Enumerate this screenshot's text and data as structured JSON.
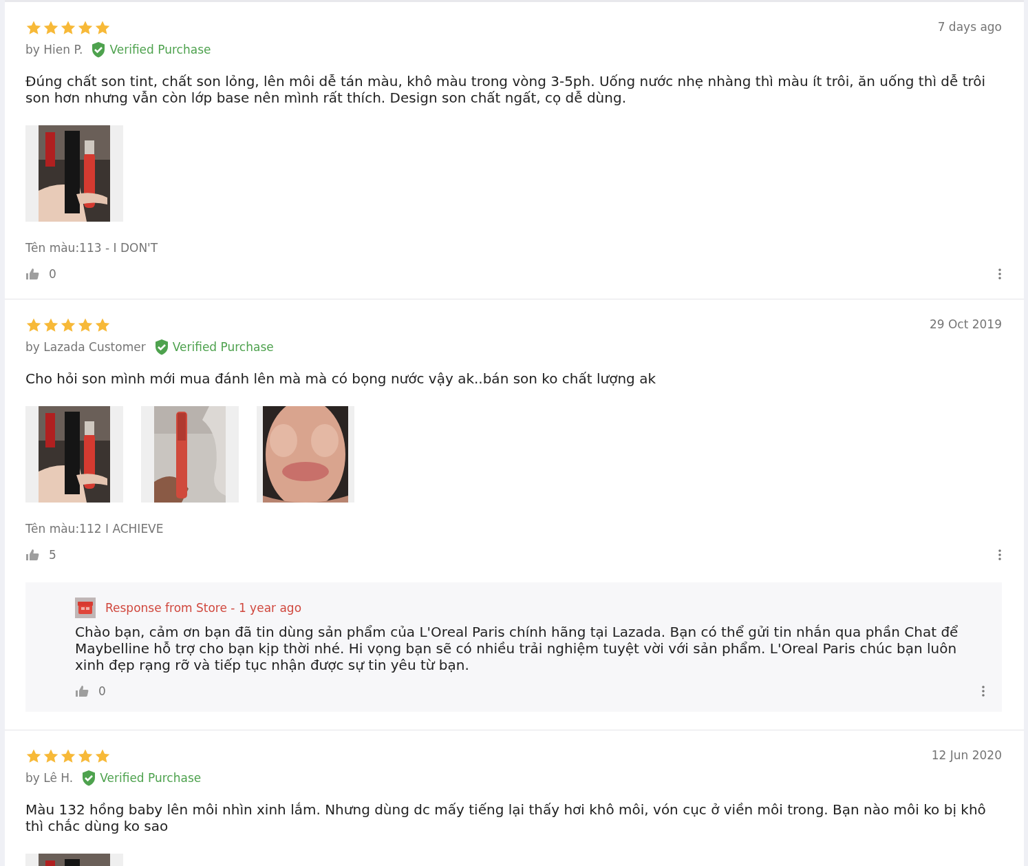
{
  "reviews": [
    {
      "stars": 5,
      "date": "7 days ago",
      "author": "by Hien P.",
      "verified": "Verified Purchase",
      "text": "Đúng chất son tint, chất son lỏng, lên môi dễ tán màu, khô màu trong vòng 3-5ph. Uống nước nhẹ nhàng thì màu ít trôi, ăn uống thì dễ trôi son hơn nhưng vẫn còn lớp base nên mình rất thích. Design son chất ngất, cọ dễ dùng.",
      "photos": [
        {
          "kind": "picture"
        }
      ],
      "variant": "Tên màu:113 - I DON'T",
      "likes": "0"
    },
    {
      "stars": 5,
      "date": "29 Oct 2019",
      "author": "by Lazada Customer",
      "verified": "Verified Purchase",
      "text": "Cho hỏi son mình mới mua đánh lên mà mà có bọng nước vậy ak..bán son ko chất lượng ak",
      "photos": [
        {
          "kind": "picture"
        },
        {
          "kind": "picture"
        },
        {
          "kind": "picture"
        }
      ],
      "variant": "Tên màu:112 I ACHIEVE",
      "likes": "5",
      "response": {
        "title": "Response from Store - 1 year ago",
        "text": "Chào bạn, cảm ơn bạn đã tin dùng sản phẩm của L'Oreal Paris chính hãng tại Lazada. Bạn có thể gửi tin nhắn qua phần Chat để Maybelline hỗ trợ cho bạn kịp thời nhé. Hi vọng bạn sẽ có nhiều trải nghiệm tuyệt vời với sản phẩm. L'Oreal Paris chúc bạn luôn xinh đẹp rạng rỡ và tiếp tục nhận được sự tin yêu từ bạn.",
        "likes": "0"
      }
    },
    {
      "stars": 5,
      "date": "12 Jun 2020",
      "author": "by Lê H.",
      "verified": "Verified Purchase",
      "text": "Màu 132 hồng baby lên môi nhìn xinh lắm. Nhưng dùng dc mấy tiếng lại thấy hơi khô môi, vón cục ở viền môi trong. Bạn nào môi ko bị khô thì chắc dùng ko sao",
      "photos": [
        {
          "kind": "picture"
        }
      ]
    }
  ]
}
